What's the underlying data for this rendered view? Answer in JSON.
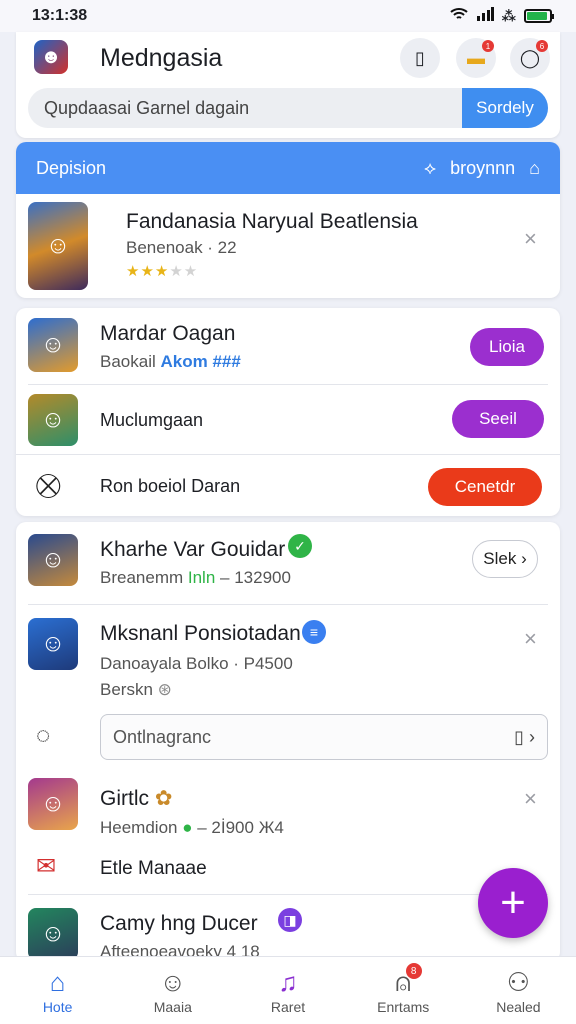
{
  "status": {
    "time": "13:1:38",
    "wifi_icon": "wifi-icon",
    "signal_icon": "signal-icon"
  },
  "header": {
    "title": "Medngasia",
    "search_placeholder": "Qupdaasai Garnel dagain",
    "search_button": "Sordely",
    "badge_two": "1",
    "badge_three": "6"
  },
  "featured": {
    "bar_label": "Depision",
    "bar_right_label": "broynnn",
    "title": "Fandanasia Naryual Beatlensia",
    "subtitle": "Benenoak · 22",
    "rating": 3
  },
  "list_a": {
    "items": [
      {
        "title": "Mardar Oagan",
        "subtitle": "Baokail",
        "subtitle_accent": "Akom ###",
        "button": "Lioia",
        "button_color": "#9b2fcf"
      },
      {
        "title": "Muclumgaan",
        "button": "Seeil",
        "button_color": "#9b2fcf"
      },
      {
        "title": "Ron boeiol Daran",
        "button": "Cenetdr",
        "button_color": "#ea3a1a"
      }
    ]
  },
  "list_b": {
    "items": [
      {
        "title": "Kharhe Var Gouidar",
        "subtitle": "Breanemm",
        "subtitle_accent": "Inln",
        "subtitle_end": "– 132900",
        "button": "Slek",
        "badge_color": "#2fb447"
      },
      {
        "title": "Mksnanl Ponsiotadan",
        "subtitle": "Danoayala Bolko · P4500",
        "subtitle2": "Berskn",
        "badge_color": "#3a7ff0"
      },
      {
        "input_placeholder": "Ontlnagranc"
      },
      {
        "title": "Girtlc",
        "subtitle": "Heemdion",
        "subtitle_end": "– 2İ900 Ж4"
      },
      {
        "title": "Etle Manaae"
      },
      {
        "title": "Camy hng Ducer",
        "subtitle": "Afteenoeavoeky 4 18",
        "badge_color": "#7b3fe0"
      }
    ]
  },
  "nav": [
    {
      "label": "Hote",
      "icon": "home-icon"
    },
    {
      "label": "Maaia",
      "icon": "chat-icon"
    },
    {
      "label": "Raret",
      "icon": "music-icon"
    },
    {
      "label": "Enrtams",
      "icon": "bell-icon",
      "badge": "8"
    },
    {
      "label": "Nealed",
      "icon": "profile-icon"
    }
  ]
}
